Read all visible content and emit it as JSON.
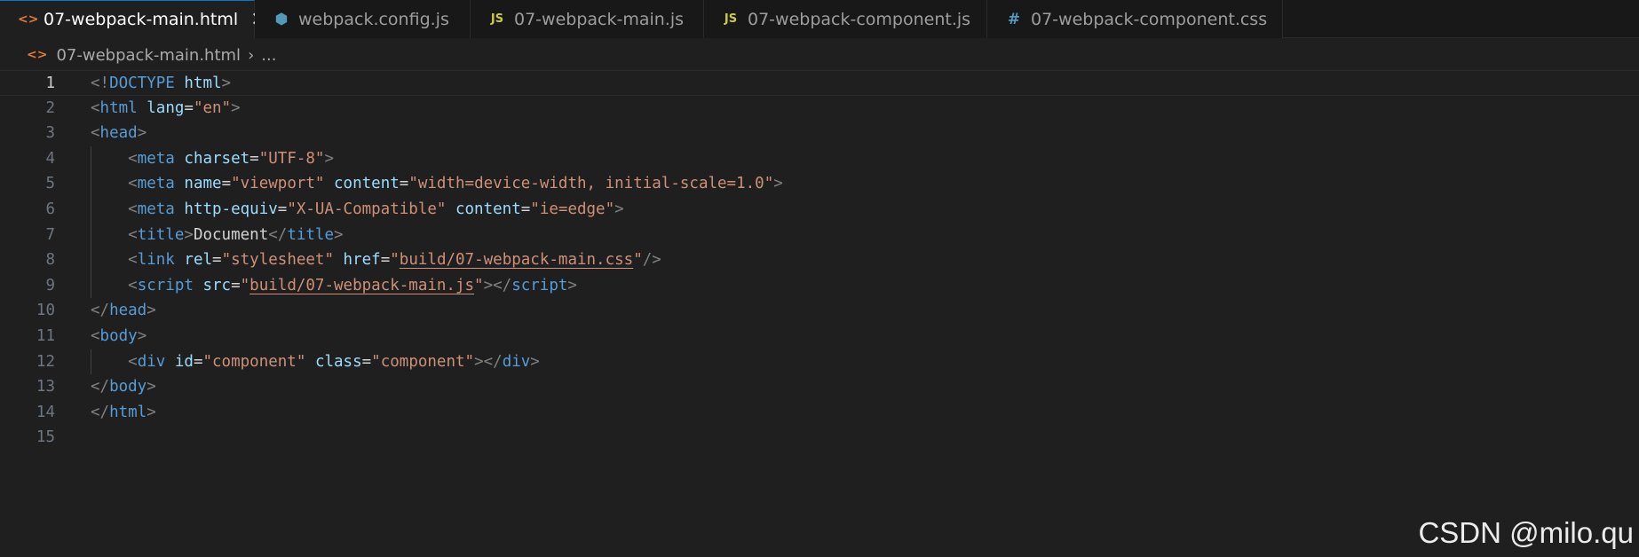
{
  "tabs": [
    {
      "icon": "html-file-icon",
      "glyph": "<>",
      "label": "07-webpack-main.html",
      "active": true,
      "width": 287
    },
    {
      "icon": "config-file-icon",
      "glyph": "⬢",
      "label": "webpack.config.js",
      "active": false,
      "width": 243
    },
    {
      "icon": "js-file-icon",
      "glyph": "JS",
      "label": "07-webpack-main.js",
      "active": false,
      "width": 263
    },
    {
      "icon": "js-file-icon",
      "glyph": "JS",
      "label": "07-webpack-component.js",
      "active": false,
      "width": 319
    },
    {
      "icon": "css-file-icon",
      "glyph": "#",
      "label": "07-webpack-component.css",
      "active": false,
      "width": 333
    }
  ],
  "tab_close_glyph": "✕",
  "breadcrumb": {
    "file": "07-webpack-main.html",
    "separator": "›",
    "more": "..."
  },
  "editor": {
    "current_line": 1,
    "lines": [
      {
        "n": "1",
        "indent": 0,
        "tokens": [
          [
            "br",
            "<!"
          ],
          [
            "tag",
            "DOCTYPE"
          ],
          [
            "txt",
            " "
          ],
          [
            "attr",
            "html"
          ],
          [
            "br",
            ">"
          ]
        ]
      },
      {
        "n": "2",
        "indent": 0,
        "tokens": [
          [
            "br",
            "<"
          ],
          [
            "tag",
            "html"
          ],
          [
            "txt",
            " "
          ],
          [
            "attr",
            "lang"
          ],
          [
            "txt",
            "="
          ],
          [
            "str",
            "\"en\""
          ],
          [
            "br",
            ">"
          ]
        ]
      },
      {
        "n": "3",
        "indent": 0,
        "tokens": [
          [
            "br",
            "<"
          ],
          [
            "tag",
            "head"
          ],
          [
            "br",
            ">"
          ]
        ]
      },
      {
        "n": "4",
        "indent": 1,
        "tokens": [
          [
            "br",
            "<"
          ],
          [
            "tag",
            "meta"
          ],
          [
            "txt",
            " "
          ],
          [
            "attr",
            "charset"
          ],
          [
            "txt",
            "="
          ],
          [
            "str",
            "\"UTF-8\""
          ],
          [
            "br",
            ">"
          ]
        ]
      },
      {
        "n": "5",
        "indent": 1,
        "tokens": [
          [
            "br",
            "<"
          ],
          [
            "tag",
            "meta"
          ],
          [
            "txt",
            " "
          ],
          [
            "attr",
            "name"
          ],
          [
            "txt",
            "="
          ],
          [
            "str",
            "\"viewport\""
          ],
          [
            "txt",
            " "
          ],
          [
            "attr",
            "content"
          ],
          [
            "txt",
            "="
          ],
          [
            "str",
            "\"width=device-width, initial-scale=1.0\""
          ],
          [
            "br",
            ">"
          ]
        ]
      },
      {
        "n": "6",
        "indent": 1,
        "tokens": [
          [
            "br",
            "<"
          ],
          [
            "tag",
            "meta"
          ],
          [
            "txt",
            " "
          ],
          [
            "attr",
            "http-equiv"
          ],
          [
            "txt",
            "="
          ],
          [
            "str",
            "\"X-UA-Compatible\""
          ],
          [
            "txt",
            " "
          ],
          [
            "attr",
            "content"
          ],
          [
            "txt",
            "="
          ],
          [
            "str",
            "\"ie=edge\""
          ],
          [
            "br",
            ">"
          ]
        ]
      },
      {
        "n": "7",
        "indent": 1,
        "tokens": [
          [
            "br",
            "<"
          ],
          [
            "tag",
            "title"
          ],
          [
            "br",
            ">"
          ],
          [
            "txt",
            "Document"
          ],
          [
            "br",
            "</"
          ],
          [
            "tag",
            "title"
          ],
          [
            "br",
            ">"
          ]
        ]
      },
      {
        "n": "8",
        "indent": 1,
        "tokens": [
          [
            "br",
            "<"
          ],
          [
            "tag",
            "link"
          ],
          [
            "txt",
            " "
          ],
          [
            "attr",
            "rel"
          ],
          [
            "txt",
            "="
          ],
          [
            "str",
            "\"stylesheet\""
          ],
          [
            "txt",
            " "
          ],
          [
            "attr",
            "href"
          ],
          [
            "txt",
            "="
          ],
          [
            "str",
            "\""
          ],
          [
            "strlink",
            "build/07-webpack-main.css"
          ],
          [
            "str",
            "\""
          ],
          [
            "br",
            "/>"
          ]
        ]
      },
      {
        "n": "9",
        "indent": 1,
        "tokens": [
          [
            "br",
            "<"
          ],
          [
            "tag",
            "script"
          ],
          [
            "txt",
            " "
          ],
          [
            "attr",
            "src"
          ],
          [
            "txt",
            "="
          ],
          [
            "str",
            "\""
          ],
          [
            "strlink",
            "build/07-webpack-main.js"
          ],
          [
            "str",
            "\""
          ],
          [
            "br",
            "></"
          ],
          [
            "tag",
            "script"
          ],
          [
            "br",
            ">"
          ]
        ]
      },
      {
        "n": "10",
        "indent": 0,
        "tokens": [
          [
            "br",
            "</"
          ],
          [
            "tag",
            "head"
          ],
          [
            "br",
            ">"
          ]
        ]
      },
      {
        "n": "11",
        "indent": 0,
        "tokens": [
          [
            "br",
            "<"
          ],
          [
            "tag",
            "body"
          ],
          [
            "br",
            ">"
          ]
        ]
      },
      {
        "n": "12",
        "indent": 1,
        "tokens": [
          [
            "br",
            "<"
          ],
          [
            "tag",
            "div"
          ],
          [
            "txt",
            " "
          ],
          [
            "attr",
            "id"
          ],
          [
            "txt",
            "="
          ],
          [
            "str",
            "\"component\""
          ],
          [
            "txt",
            " "
          ],
          [
            "attr",
            "class"
          ],
          [
            "txt",
            "="
          ],
          [
            "str",
            "\"component\""
          ],
          [
            "br",
            "></"
          ],
          [
            "tag",
            "div"
          ],
          [
            "br",
            ">"
          ]
        ]
      },
      {
        "n": "13",
        "indent": 0,
        "tokens": [
          [
            "br",
            "</"
          ],
          [
            "tag",
            "body"
          ],
          [
            "br",
            ">"
          ]
        ]
      },
      {
        "n": "14",
        "indent": 0,
        "tokens": [
          [
            "br",
            "</"
          ],
          [
            "tag",
            "html"
          ],
          [
            "br",
            ">"
          ]
        ]
      },
      {
        "n": "15",
        "indent": 0,
        "tokens": []
      }
    ]
  },
  "watermark": "CSDN @milo.qu"
}
